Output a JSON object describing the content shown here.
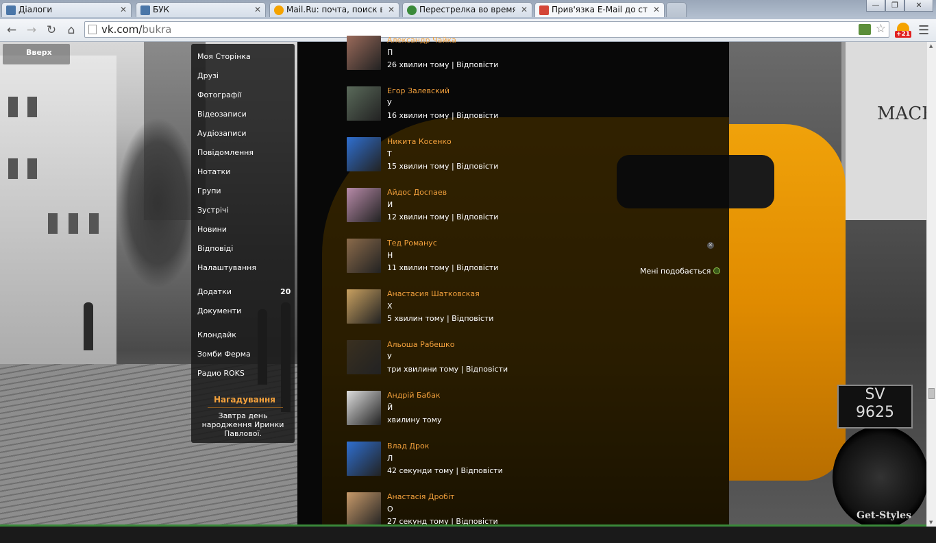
{
  "browser": {
    "tabs": [
      {
        "title": "Діалоги",
        "favicon_color": "#4a76a8",
        "active": false
      },
      {
        "title": "БУК",
        "favicon_color": "#4a76a8",
        "active": false
      },
      {
        "title": "Mail.Ru: почта, поиск в и",
        "favicon_color": "#f5a300",
        "active": false
      },
      {
        "title": "Перестрелка во время п",
        "favicon_color": "#3a8a3a",
        "active": false
      },
      {
        "title": "Прив'язка E-Mail до стор",
        "favicon_color": "#d44638",
        "active": true
      }
    ],
    "url_host": "vk.com/",
    "url_path": "bukra",
    "mail_count": "+21",
    "window_buttons": {
      "minimize": "—",
      "maximize": "❐",
      "close": "✕"
    }
  },
  "vk": {
    "up_button": "Вверх",
    "menu": [
      {
        "label": "Моя Сторінка"
      },
      {
        "label": "Друзі"
      },
      {
        "label": "Фотографії"
      },
      {
        "label": "Відеозаписи"
      },
      {
        "label": "Аудіозаписи"
      },
      {
        "label": "Повідомлення"
      },
      {
        "label": "Нотатки"
      },
      {
        "label": "Групи"
      },
      {
        "label": "Зустрічі"
      },
      {
        "label": "Новини"
      },
      {
        "label": "Відповіді"
      },
      {
        "label": "Налаштування"
      },
      {
        "label": "Додатки",
        "badge": "20"
      },
      {
        "label": "Документи"
      },
      {
        "label": "Клондайк"
      },
      {
        "label": "Зомби Ферма"
      },
      {
        "label": "Радио ROKS"
      }
    ],
    "reminder": {
      "title": "Нагадування",
      "text": "Завтра день народження Иринки Павлової."
    },
    "feed": [
      {
        "name": "Александр Чайка",
        "message": "П",
        "time": "26 хвилин тому",
        "reply": "| Відповісти",
        "avatar_color": "#9a6a5a"
      },
      {
        "name": "Егор Залевский",
        "message": "У",
        "time": "16 хвилин тому",
        "reply": "| Відповісти",
        "avatar_color": "#5a6a5a"
      },
      {
        "name": "Никита Косенко",
        "message": "Т",
        "time": "15 хвилин тому",
        "reply": "| Відповісти",
        "avatar_color": "#2f6fd0"
      },
      {
        "name": "Айдос Доспаев",
        "message": "И",
        "time": "12 хвилин тому",
        "reply": "| Відповісти",
        "avatar_color": "#b78aa8"
      },
      {
        "name": "Тед Романус",
        "message": "Н",
        "time": "11 хвилин тому",
        "reply": "| Відповісти",
        "avatar_color": "#8a6a4a"
      },
      {
        "name": "Анастасия Шатковская",
        "message": "Х",
        "time": "5 хвилин тому",
        "reply": "| Відповісти",
        "avatar_color": "#c8a060"
      },
      {
        "name": "Альоша Рабешко",
        "message": "У",
        "time": "три хвилини тому",
        "reply": "| Відповісти",
        "avatar_color": "#3a3020"
      },
      {
        "name": "Андрій Бабак",
        "message": "Й",
        "time": "хвилину тому",
        "reply": "",
        "avatar_color": "#dddddd"
      },
      {
        "name": "Влад Дрок",
        "message": "Л",
        "time": "42 секунди тому",
        "reply": "| Відповісти",
        "avatar_color": "#2f6fd0"
      },
      {
        "name": "Анастасія Дробіт",
        "message": "О",
        "time": "27 секунд тому",
        "reply": "| Відповісти",
        "avatar_color": "#c89a6a"
      }
    ],
    "like_label": "Мені подобається",
    "watermark": "Get-Styles"
  }
}
